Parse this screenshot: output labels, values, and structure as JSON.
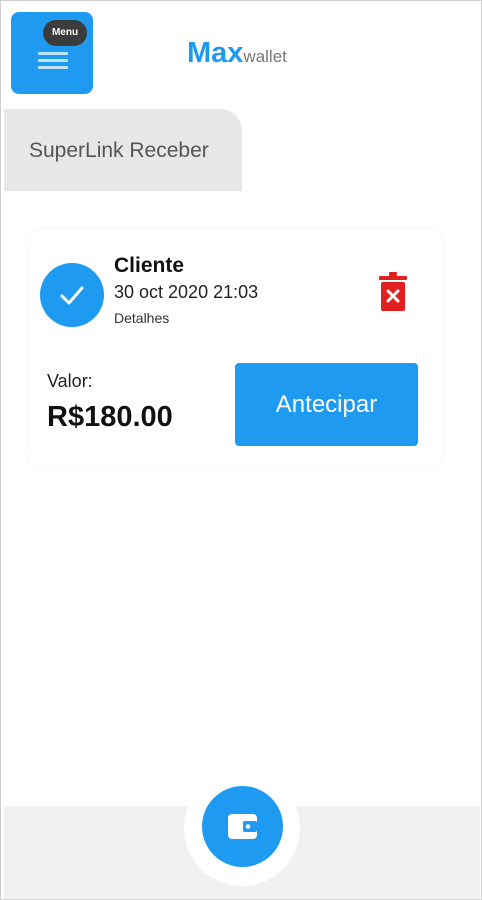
{
  "header": {
    "menu_label": "Menu",
    "brand_primary": "Max",
    "brand_secondary": "wallet",
    "menu_icon": "hamburger-menu-icon"
  },
  "tabs": [
    {
      "label": "SuperLink Receber",
      "active": true
    }
  ],
  "card": {
    "status_icon": "check-icon",
    "client": "Cliente",
    "datetime": "30 oct 2020 21:03",
    "details_link": "Detalhes",
    "delete_icon": "trash-icon",
    "value_label": "Valor:",
    "value": "R$180.00",
    "action_label": "Antecipar"
  },
  "bottom_nav": {
    "center_icon": "wallet-icon"
  },
  "colors": {
    "primary": "#1e9bf0",
    "danger": "#e0211f",
    "tab_bg": "#e7e7e7",
    "bottom_bar_bg": "#f1f1f1"
  }
}
